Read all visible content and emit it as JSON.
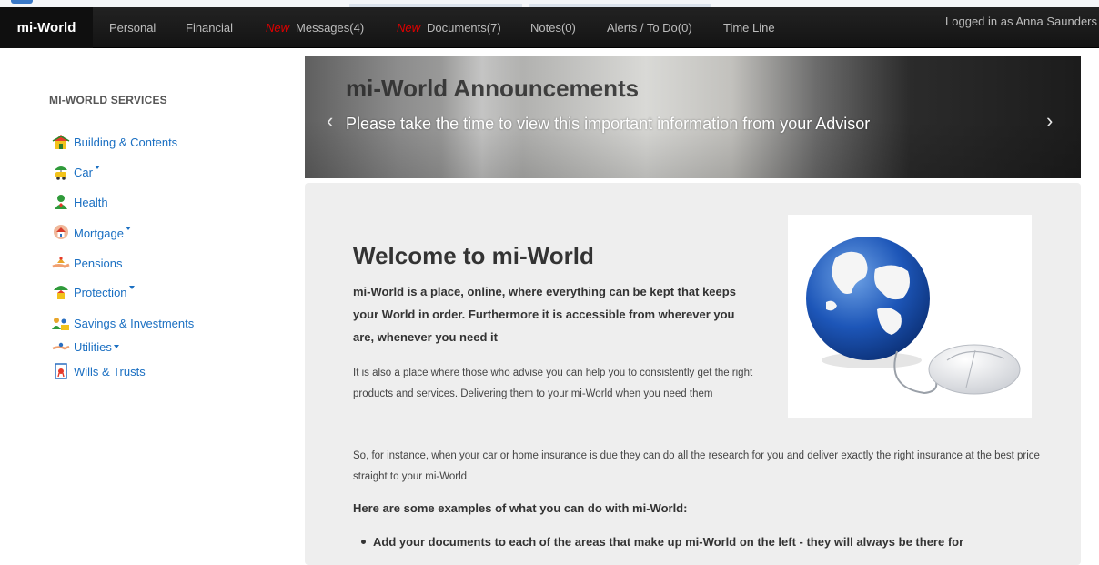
{
  "nav": {
    "brand": "mi-World",
    "links": [
      {
        "label": "Personal",
        "new": ""
      },
      {
        "label": "Financial",
        "new": ""
      },
      {
        "label": "Messages(4)",
        "new": "New"
      },
      {
        "label": "Documents(7)",
        "new": "New"
      },
      {
        "label": "Notes(0)",
        "new": ""
      },
      {
        "label": "Alerts / To Do(0)",
        "new": ""
      },
      {
        "label": "Time Line",
        "new": ""
      }
    ],
    "login_text": "Logged in as Anna Saunders"
  },
  "sidebar": {
    "title": "MI-WORLD SERVICES",
    "items": [
      {
        "label": "Building & Contents",
        "icon": "house-umbrella-icon",
        "dropdown": false
      },
      {
        "label": "Car",
        "icon": "car-umbrella-icon",
        "dropdown": true
      },
      {
        "label": "Health",
        "icon": "health-icon",
        "dropdown": false
      },
      {
        "label": "Mortgage",
        "icon": "mortgage-hands-house-icon",
        "dropdown": true
      },
      {
        "label": "Pensions",
        "icon": "pension-hand-icon",
        "dropdown": false
      },
      {
        "label": "Protection",
        "icon": "protection-umbrella-icon",
        "dropdown": true
      },
      {
        "label": "Savings & Investments",
        "icon": "savings-people-icon",
        "dropdown": false
      },
      {
        "label": "Utilities",
        "icon": "utilities-hand-icon",
        "dropdown": true
      },
      {
        "label": "Wills & Trusts",
        "icon": "wills-document-icon",
        "dropdown": false
      }
    ]
  },
  "banner": {
    "title": "mi-World Announcements",
    "text": "Please take the time to view this important information from your Advisor",
    "prev": "‹",
    "next": "›"
  },
  "main": {
    "welcome": "Welcome to mi-World",
    "lead": "mi-World is a place, online, where everything can be kept that keeps your World in order. Furthermore it is accessible from wherever you are, whenever you need it",
    "para1": "It is also a place where those who advise you can help you to consistently get the right products and services. Delivering them to your mi-World when you need them",
    "para2": "So, for instance, when your car or home insurance is due they can do all the research for you and deliver exactly the right insurance at the best price straight to your mi-World",
    "examples_title": "Here are some examples of what you can do with mi-World:",
    "bullet1": "Add your documents to each of the areas that make up mi-World on the left - they will always be there for"
  },
  "colors": {
    "nav_bg": "#1d1d1d",
    "link_blue": "#1a6fc2",
    "new_red": "#e00000",
    "panel_bg": "#eeeeee"
  }
}
